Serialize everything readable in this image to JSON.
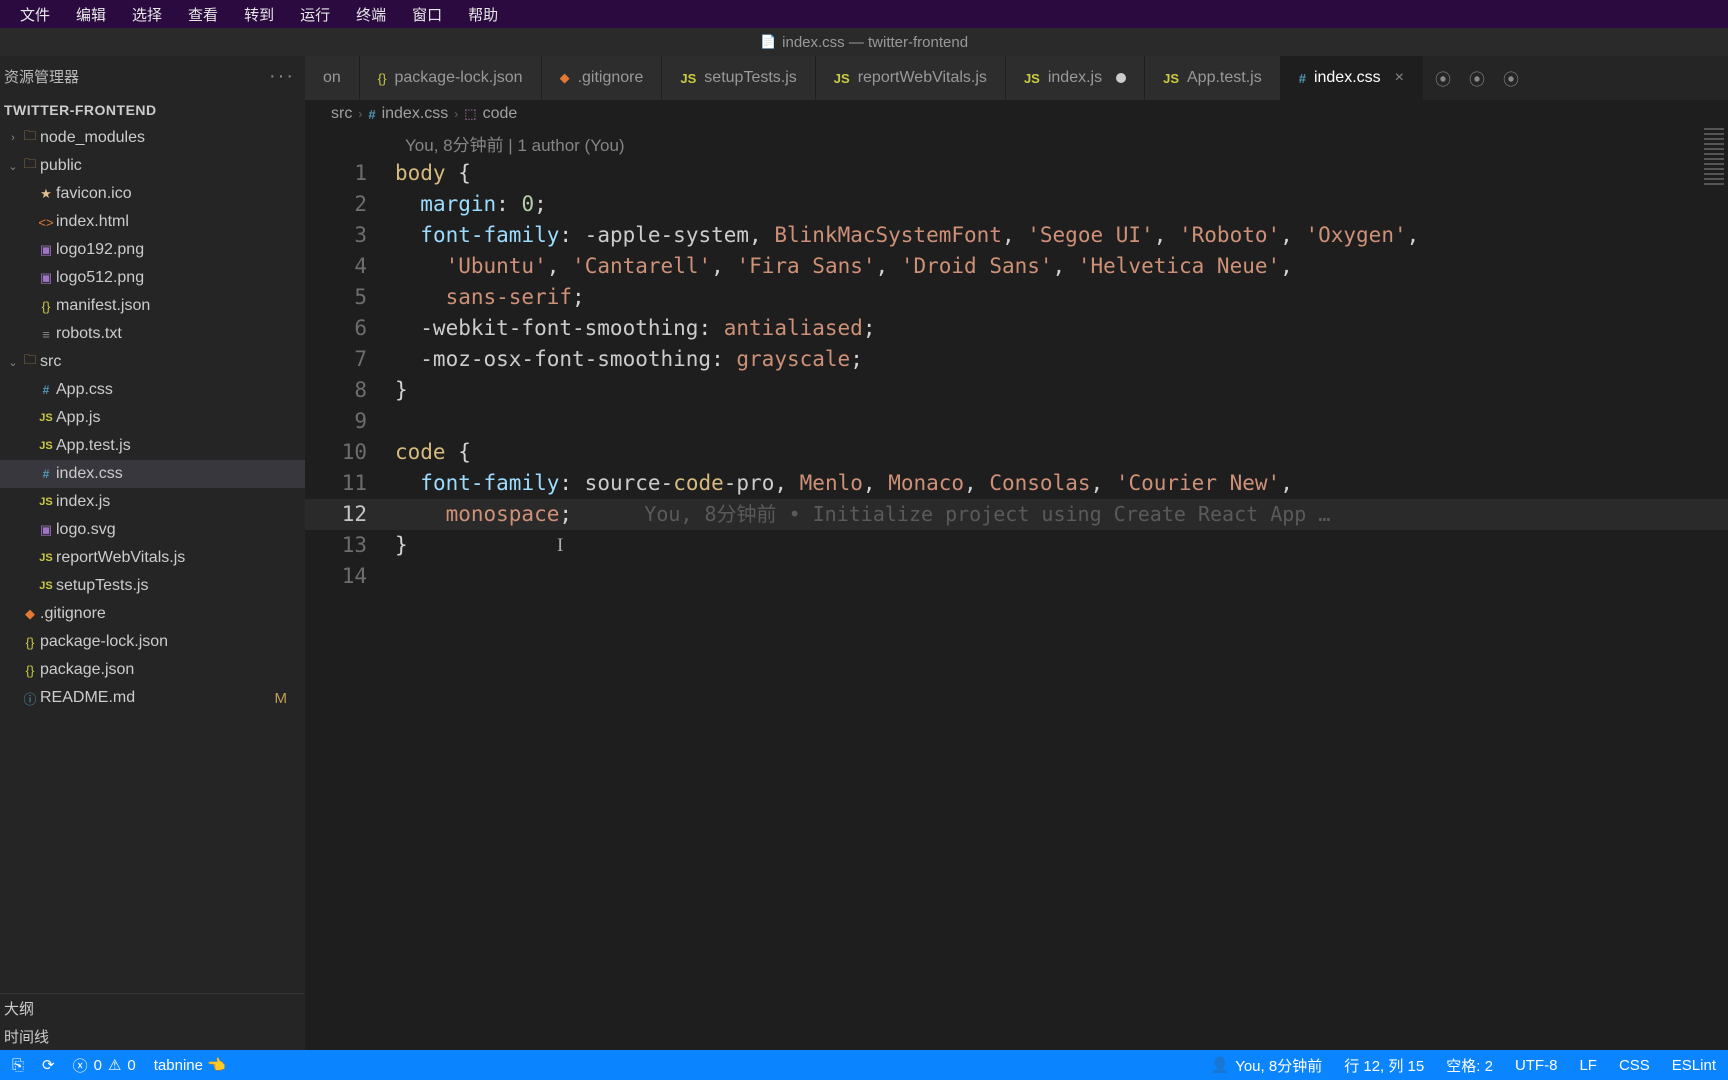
{
  "menubar": [
    "文件",
    "编辑",
    "选择",
    "查看",
    "转到",
    "运行",
    "终端",
    "窗口",
    "帮助"
  ],
  "titlebar": {
    "label": "index.css — twitter-frontend"
  },
  "sidebar": {
    "header": "资源管理器",
    "project": "TWITTER-FRONTEND",
    "outline": "大纲",
    "timeline": "时间线",
    "tree": [
      {
        "label": "node_modules",
        "icon": "folder",
        "depth": 1,
        "chev": "›"
      },
      {
        "label": "public",
        "icon": "folder",
        "depth": 1,
        "chev": "⌄"
      },
      {
        "label": "favicon.ico",
        "icon": "star",
        "depth": 2
      },
      {
        "label": "index.html",
        "icon": "html",
        "depth": 2
      },
      {
        "label": "logo192.png",
        "icon": "img",
        "depth": 2
      },
      {
        "label": "logo512.png",
        "icon": "img",
        "depth": 2
      },
      {
        "label": "manifest.json",
        "icon": "json",
        "depth": 2
      },
      {
        "label": "robots.txt",
        "icon": "txt",
        "depth": 2
      },
      {
        "label": "src",
        "icon": "folder",
        "depth": 1,
        "chev": "⌄"
      },
      {
        "label": "App.css",
        "icon": "css",
        "depth": 2
      },
      {
        "label": "App.js",
        "icon": "js",
        "depth": 2
      },
      {
        "label": "App.test.js",
        "icon": "js",
        "depth": 2
      },
      {
        "label": "index.css",
        "icon": "css",
        "depth": 2,
        "selected": true
      },
      {
        "label": "index.js",
        "icon": "js",
        "depth": 2
      },
      {
        "label": "logo.svg",
        "icon": "img",
        "depth": 2
      },
      {
        "label": "reportWebVitals.js",
        "icon": "js",
        "depth": 2
      },
      {
        "label": "setupTests.js",
        "icon": "js",
        "depth": 2
      },
      {
        "label": ".gitignore",
        "icon": "git",
        "depth": 1
      },
      {
        "label": "package-lock.json",
        "icon": "json",
        "depth": 1
      },
      {
        "label": "package.json",
        "icon": "json",
        "depth": 1
      },
      {
        "label": "README.md",
        "icon": "md",
        "depth": 1,
        "status": "M"
      }
    ]
  },
  "tabs": [
    {
      "label": "on",
      "icon": ""
    },
    {
      "label": "package-lock.json",
      "icon": "{}"
    },
    {
      "label": ".gitignore",
      "icon": "◆"
    },
    {
      "label": "setupTests.js",
      "icon": "JS"
    },
    {
      "label": "reportWebVitals.js",
      "icon": "JS"
    },
    {
      "label": "index.js",
      "icon": "JS",
      "modified": true
    },
    {
      "label": "App.test.js",
      "icon": "JS"
    },
    {
      "label": "index.css",
      "icon": "#",
      "active": true,
      "close": true
    }
  ],
  "crumb": [
    "src",
    "index.css",
    "code"
  ],
  "lens": "You, 8分钟前 | 1 author (You)",
  "inline_lens": "You, 8分钟前 • Initialize project using Create React App …",
  "code": {
    "lines": [
      "body {",
      "  margin: 0;",
      "  font-family: -apple-system, BlinkMacSystemFont, 'Segoe UI', 'Roboto', 'Oxygen',",
      "    'Ubuntu', 'Cantarell', 'Fira Sans', 'Droid Sans', 'Helvetica Neue',",
      "    sans-serif;",
      "  -webkit-font-smoothing: antialiased;",
      "  -moz-osx-font-smoothing: grayscale;",
      "}",
      "",
      "code {",
      "  font-family: source-code-pro, Menlo, Monaco, Consolas, 'Courier New',",
      "    monospace;",
      "}",
      ""
    ]
  },
  "status": {
    "errors": "0",
    "warnings": "0",
    "tabnine": "tabnine 👈",
    "blame": "You, 8分钟前",
    "ln": "行 12, 列 15",
    "spaces": "空格: 2",
    "enc": "UTF-8",
    "eol": "LF",
    "lang": "CSS",
    "eslint": "ESLint"
  }
}
